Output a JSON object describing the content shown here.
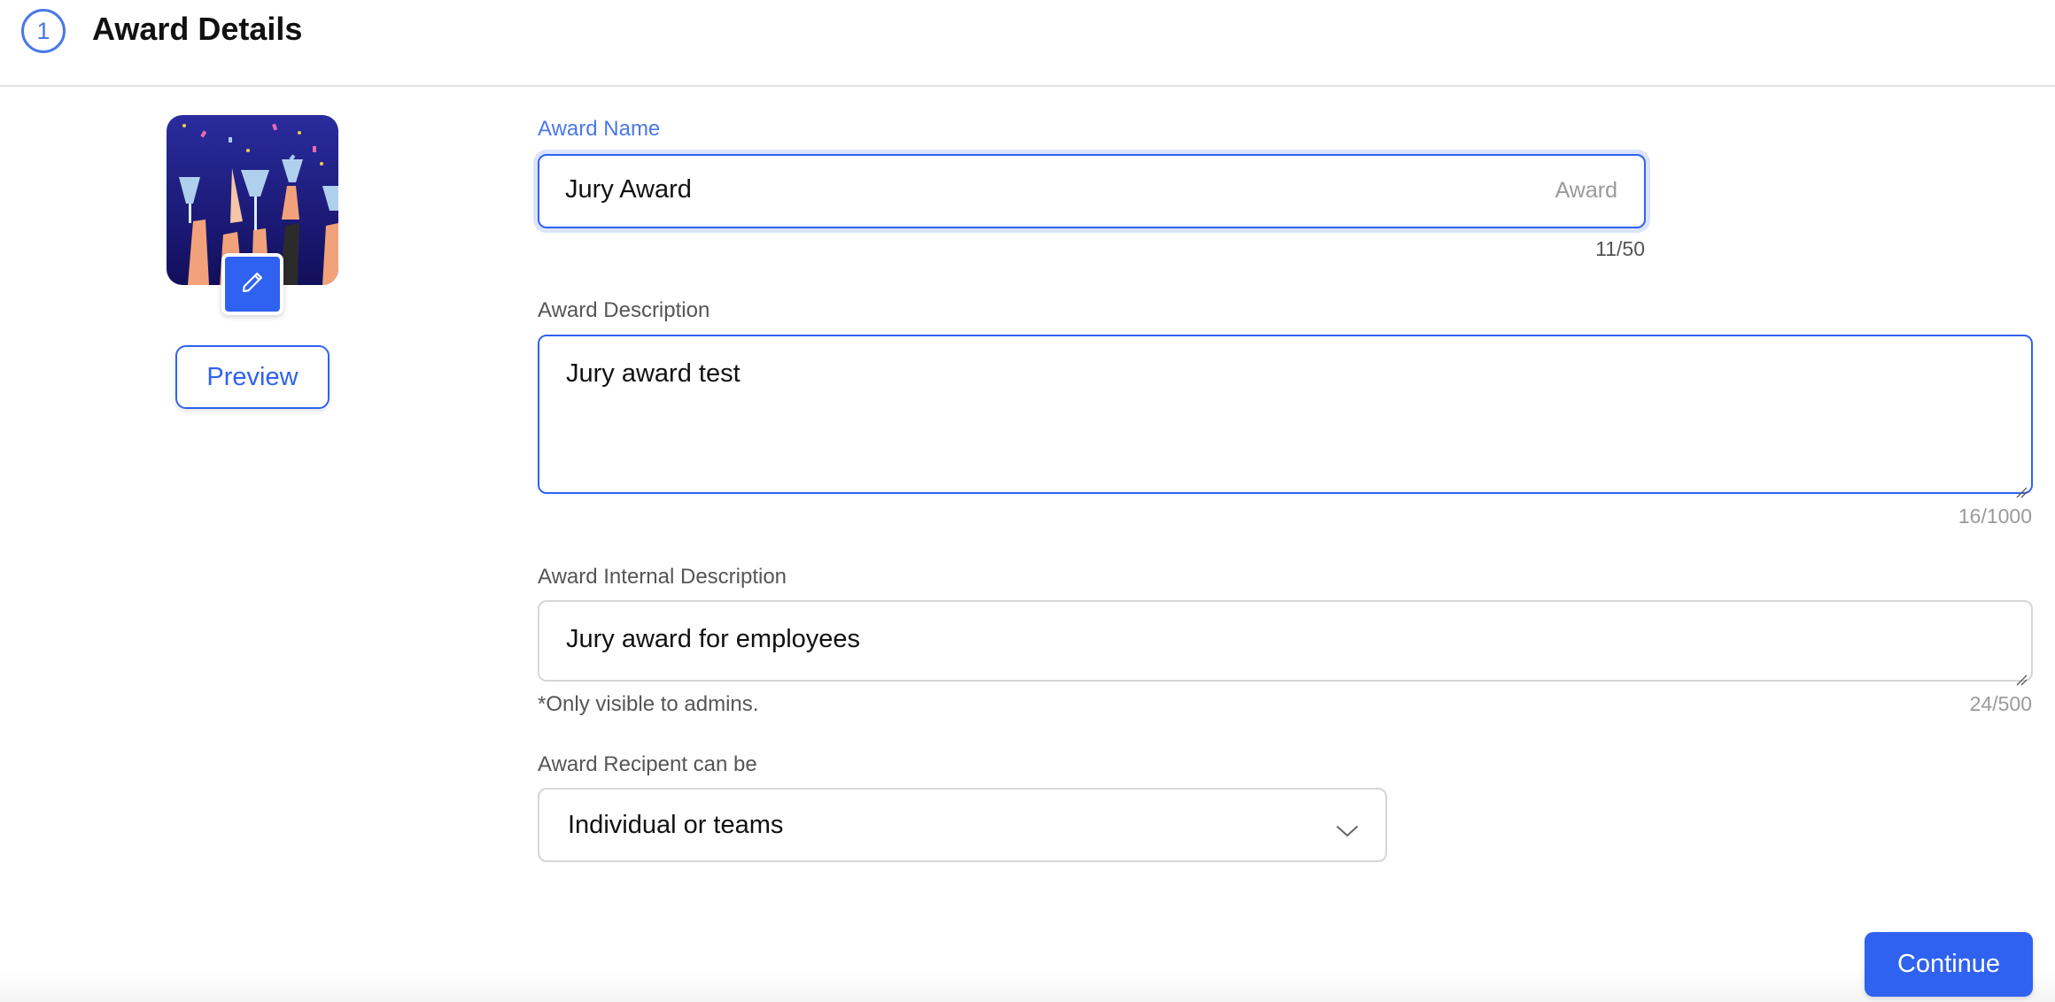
{
  "header": {
    "step_number": "1",
    "title": "Award Details"
  },
  "sidebar": {
    "preview_label": "Preview"
  },
  "form": {
    "award_name": {
      "label": "Award Name",
      "value": "Jury Award",
      "suffix": "Award",
      "counter": "11/50"
    },
    "award_description": {
      "label": "Award Description",
      "value": "Jury award test",
      "counter": "16/1000"
    },
    "award_internal_description": {
      "label": "Award Internal Description",
      "value": "Jury award for employees",
      "hint": "*Only visible to admins.",
      "counter": "24/500"
    },
    "award_recipient": {
      "label": "Award Recipent can be",
      "selected": "Individual or teams"
    }
  },
  "footer": {
    "continue_label": "Continue"
  },
  "colors": {
    "accent": "#2f62f0",
    "step_circle": "#4a78e8",
    "focus_ring": "#dbe4fb",
    "border": "#d6d6d6"
  },
  "icons": {
    "edit": "pencil-icon",
    "dropdown": "chevron-down-icon"
  }
}
